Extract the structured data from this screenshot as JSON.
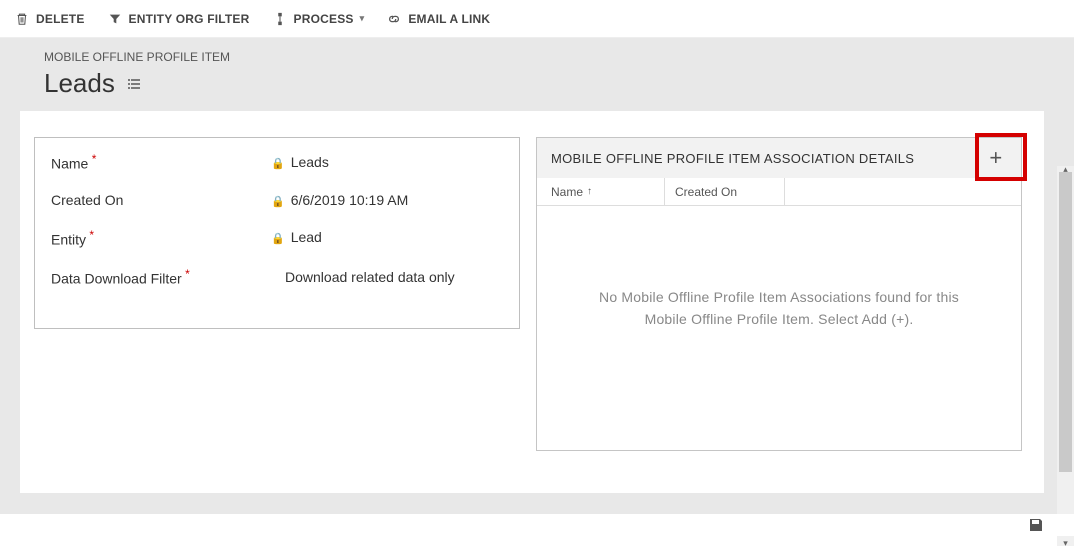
{
  "toolbar": {
    "delete": "DELETE",
    "entityOrgFilter": "ENTITY ORG FILTER",
    "process": "PROCESS",
    "emailLink": "EMAIL A LINK"
  },
  "breadcrumb": "MOBILE OFFLINE PROFILE ITEM",
  "title": "Leads",
  "form": {
    "nameLabel": "Name",
    "nameValue": "Leads",
    "createdOnLabel": "Created On",
    "createdOnValue": "6/6/2019  10:19 AM",
    "entityLabel": "Entity",
    "entityValue": "Lead",
    "dataDownloadFilterLabel": "Data Download Filter",
    "dataDownloadFilterValue": "Download related data only"
  },
  "assocPanel": {
    "header": "MOBILE OFFLINE PROFILE ITEM ASSOCIATION DETAILS",
    "colName": "Name",
    "colCreatedOn": "Created On",
    "emptyMessage": "No Mobile Offline Profile Item Associations found for this Mobile Offline Profile Item. Select Add (+)."
  }
}
